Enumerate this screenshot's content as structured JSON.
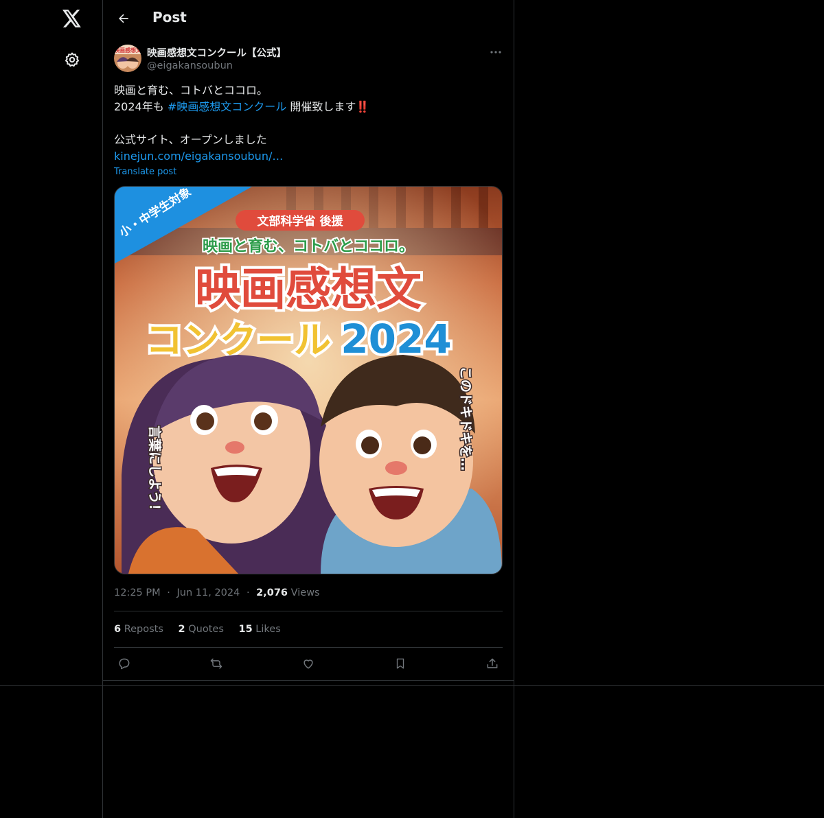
{
  "header": {
    "title": "Post"
  },
  "author": {
    "name": "映画感想文コンクール【公式】",
    "handle": "@eigakansoubun",
    "avatar_text": "映画感想文"
  },
  "post": {
    "line1": "映画と育む、コトバとココロ。",
    "line2_prefix": "2024年も ",
    "hashtag": "#映画感想文コンクール",
    "line2_suffix": " 開催致します",
    "line2_emoji": "‼️",
    "line4": "公式サイト、オープンしました",
    "link": "kinejun.com/eigakansoubun/…",
    "translate": "Translate post"
  },
  "media": {
    "corner_banner": "小・中学生対象",
    "sponsor": "文部科学省 後援",
    "tagline": "映画と育む、コトバとココロ。",
    "title_main": "映画感想文",
    "title_sub": "コンクール",
    "title_year": "2024",
    "side_right": "このドキドキを…",
    "side_left": "言葉にしよう！",
    "colors": {
      "title_red": "#e04b3c",
      "title_yellow": "#f1c232",
      "title_blue": "#1f8fd6",
      "banner_blue": "#1e90e0"
    }
  },
  "meta": {
    "time": "12:25 PM",
    "dot": "·",
    "date": "Jun 11, 2024",
    "views_count": "2,076",
    "views_label": "Views"
  },
  "stats": {
    "reposts_count": "6",
    "reposts_label": "Reposts",
    "quotes_count": "2",
    "quotes_label": "Quotes",
    "likes_count": "15",
    "likes_label": "Likes"
  },
  "icons": [
    "x-logo-icon",
    "settings-gear-icon",
    "back-arrow-icon",
    "more-icon",
    "reply-icon",
    "repost-icon",
    "like-icon",
    "bookmark-icon",
    "share-icon"
  ]
}
